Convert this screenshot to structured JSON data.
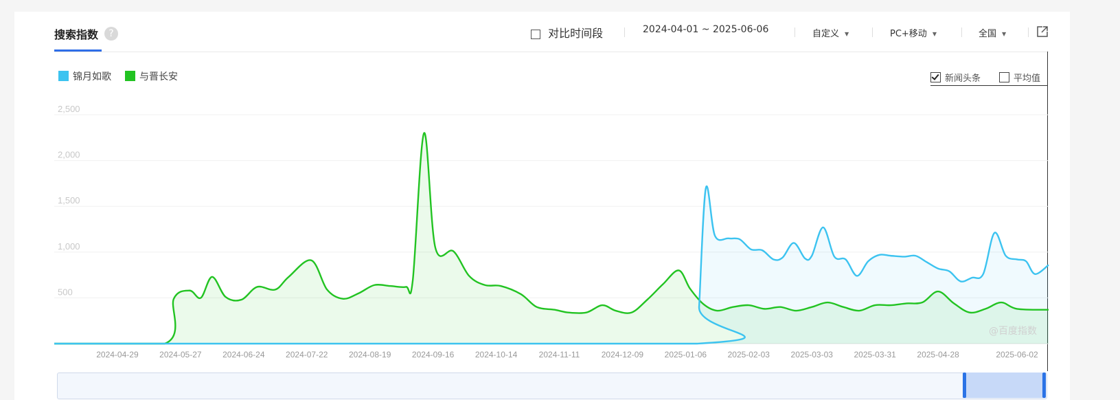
{
  "header": {
    "title": "搜索指数",
    "help_icon": "?",
    "compare_label": "对比时间段",
    "date_range": "2024-04-01 ~ 2025-06-06",
    "custom_label": "自定义",
    "device_label": "PC+移动",
    "region_label": "全国"
  },
  "legend": {
    "series1": "锦月如歌",
    "series2": "与晋长安"
  },
  "options": {
    "news_label": "新闻头条",
    "news_checked": true,
    "avg_label": "平均值",
    "avg_checked": false
  },
  "watermark": "@百度指数",
  "colors": {
    "series1": "#3cc3f0",
    "series2": "#22c322",
    "accent": "#2f6ee8"
  },
  "chart_data": {
    "type": "area",
    "ylim": [
      0,
      2500
    ],
    "yticks": [
      "2,500",
      "2,000",
      "1,500",
      "1,000",
      "500"
    ],
    "x_tick_labels": [
      "2024-04-29",
      "2024-05-27",
      "2024-06-24",
      "2024-07-22",
      "2024-08-19",
      "2024-09-16",
      "2024-10-14",
      "2024-11-11",
      "2024-12-09",
      "2025-01-06",
      "2025-02-03",
      "2025-03-03",
      "2025-03-31",
      "2025-04-28",
      "2025-06-02"
    ],
    "series": [
      {
        "name": "锦月如歌",
        "points": [
          [
            "2024-04-01",
            0
          ],
          [
            "2025-01-11",
            0
          ],
          [
            "2025-01-12",
            400
          ],
          [
            "2025-01-15",
            1700
          ],
          [
            "2025-01-19",
            1180
          ],
          [
            "2025-01-25",
            1150
          ],
          [
            "2025-01-30",
            1140
          ],
          [
            "2025-02-04",
            1030
          ],
          [
            "2025-02-09",
            1020
          ],
          [
            "2025-02-14",
            920
          ],
          [
            "2025-02-18",
            940
          ],
          [
            "2025-02-23",
            1100
          ],
          [
            "2025-02-28",
            930
          ],
          [
            "2025-03-03",
            960
          ],
          [
            "2025-03-08",
            1270
          ],
          [
            "2025-03-13",
            950
          ],
          [
            "2025-03-18",
            920
          ],
          [
            "2025-03-23",
            740
          ],
          [
            "2025-03-28",
            900
          ],
          [
            "2025-04-02",
            970
          ],
          [
            "2025-04-07",
            960
          ],
          [
            "2025-04-13",
            950
          ],
          [
            "2025-04-18",
            960
          ],
          [
            "2025-04-23",
            890
          ],
          [
            "2025-04-28",
            820
          ],
          [
            "2025-05-03",
            790
          ],
          [
            "2025-05-08",
            680
          ],
          [
            "2025-05-13",
            720
          ],
          [
            "2025-05-18",
            760
          ],
          [
            "2025-05-23",
            1210
          ],
          [
            "2025-05-28",
            960
          ],
          [
            "2025-06-02",
            920
          ],
          [
            "2025-06-06",
            900
          ],
          [
            "2025-06-10",
            760
          ],
          [
            "2025-06-16",
            860
          ]
        ]
      },
      {
        "name": "与晋长安",
        "points": [
          [
            "2024-04-01",
            0
          ],
          [
            "2024-05-20",
            0
          ],
          [
            "2024-05-24",
            490
          ],
          [
            "2024-05-31",
            580
          ],
          [
            "2024-06-05",
            500
          ],
          [
            "2024-06-10",
            730
          ],
          [
            "2024-06-16",
            510
          ],
          [
            "2024-06-23",
            480
          ],
          [
            "2024-06-30",
            620
          ],
          [
            "2024-07-08",
            590
          ],
          [
            "2024-07-14",
            730
          ],
          [
            "2024-07-24",
            910
          ],
          [
            "2024-07-31",
            590
          ],
          [
            "2024-08-07",
            490
          ],
          [
            "2024-08-14",
            550
          ],
          [
            "2024-08-21",
            640
          ],
          [
            "2024-08-28",
            630
          ],
          [
            "2024-09-04",
            620
          ],
          [
            "2024-09-07",
            690
          ],
          [
            "2024-09-12",
            2300
          ],
          [
            "2024-09-17",
            1050
          ],
          [
            "2024-09-25",
            1010
          ],
          [
            "2024-10-02",
            740
          ],
          [
            "2024-10-09",
            640
          ],
          [
            "2024-10-16",
            630
          ],
          [
            "2024-10-25",
            540
          ],
          [
            "2024-11-01",
            400
          ],
          [
            "2024-11-09",
            370
          ],
          [
            "2024-11-15",
            340
          ],
          [
            "2024-11-23",
            340
          ],
          [
            "2024-11-30",
            420
          ],
          [
            "2024-12-06",
            360
          ],
          [
            "2024-12-13",
            340
          ],
          [
            "2024-12-20",
            480
          ],
          [
            "2024-12-27",
            650
          ],
          [
            "2025-01-03",
            800
          ],
          [
            "2025-01-08",
            600
          ],
          [
            "2025-01-14",
            430
          ],
          [
            "2025-01-20",
            360
          ],
          [
            "2025-01-27",
            400
          ],
          [
            "2025-02-03",
            420
          ],
          [
            "2025-02-10",
            380
          ],
          [
            "2025-02-17",
            400
          ],
          [
            "2025-02-24",
            360
          ],
          [
            "2025-03-03",
            400
          ],
          [
            "2025-03-10",
            450
          ],
          [
            "2025-03-17",
            400
          ],
          [
            "2025-03-24",
            360
          ],
          [
            "2025-03-31",
            420
          ],
          [
            "2025-04-07",
            420
          ],
          [
            "2025-04-14",
            440
          ],
          [
            "2025-04-21",
            450
          ],
          [
            "2025-04-28",
            570
          ],
          [
            "2025-05-05",
            440
          ],
          [
            "2025-05-12",
            340
          ],
          [
            "2025-05-19",
            380
          ],
          [
            "2025-05-26",
            450
          ],
          [
            "2025-06-02",
            380
          ],
          [
            "2025-06-16",
            370
          ]
        ]
      }
    ]
  }
}
